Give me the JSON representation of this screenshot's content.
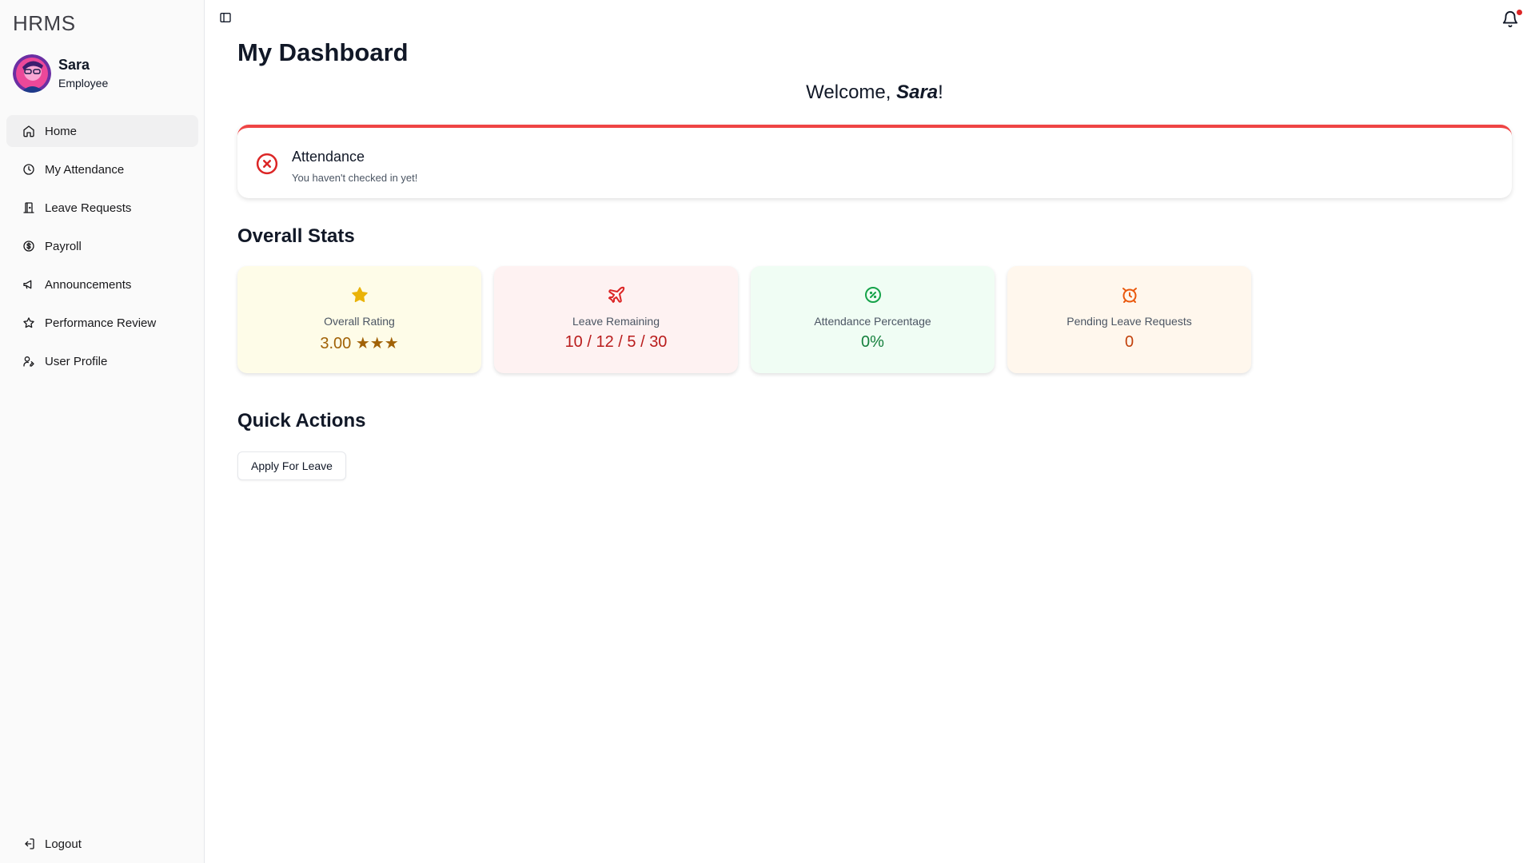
{
  "app": {
    "brand": "HRMS"
  },
  "user": {
    "name": "Sara",
    "role": "Employee"
  },
  "sidebar": {
    "items": [
      {
        "label": "Home",
        "icon": "home-icon",
        "active": true
      },
      {
        "label": "My Attendance",
        "icon": "clock-icon"
      },
      {
        "label": "Leave Requests",
        "icon": "door-icon"
      },
      {
        "label": "Payroll",
        "icon": "dollar-circle-icon"
      },
      {
        "label": "Announcements",
        "icon": "megaphone-icon"
      },
      {
        "label": "Performance Review",
        "icon": "star-icon"
      },
      {
        "label": "User Profile",
        "icon": "user-pen-icon"
      }
    ],
    "logout_label": "Logout"
  },
  "main": {
    "title": "My Dashboard",
    "welcome_prefix": "Welcome, ",
    "welcome_name": "Sara",
    "welcome_suffix": "!",
    "alert": {
      "title": "Attendance",
      "description": "You haven't checked in yet!",
      "color": "#dc2626"
    },
    "stats_title": "Overall Stats",
    "stats": [
      {
        "label": "Overall Rating",
        "value": "3.00 ★★★",
        "icon": "star-icon",
        "bg": "#fefce8",
        "color": "#a16207",
        "icon_color": "#eab308"
      },
      {
        "label": "Leave Remaining",
        "value": "10 / 12 / 5 / 30",
        "icon": "plane-icon",
        "bg": "#fef2f2",
        "color": "#b91c1c",
        "icon_color": "#dc2626"
      },
      {
        "label": "Attendance Percentage",
        "value": "0%",
        "icon": "percent-badge-icon",
        "bg": "#f0fdf4",
        "color": "#15803d",
        "icon_color": "#16a34a"
      },
      {
        "label": "Pending Leave Requests",
        "value": "0",
        "icon": "alarm-clock-icon",
        "bg": "#fff7ed",
        "color": "#c2410c",
        "icon_color": "#ea580c"
      }
    ],
    "quick_actions_title": "Quick Actions",
    "apply_leave_label": "Apply For Leave"
  }
}
